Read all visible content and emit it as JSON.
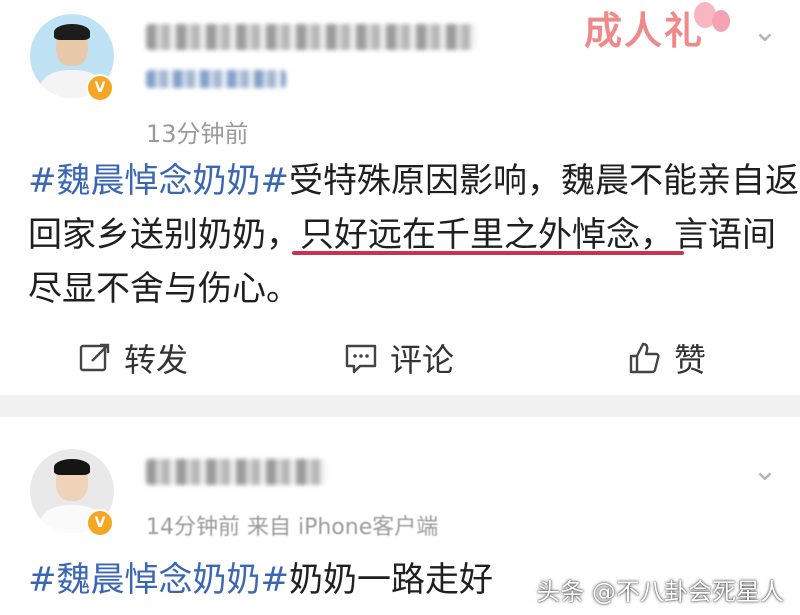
{
  "post1": {
    "time": "13分钟前",
    "sticker_text": "成人礼",
    "hashtag": "#魏晨悼念奶奶#",
    "line1_rest": "受特殊原因影响，魏晨不能亲自返",
    "line2_pre": "回家乡送别奶奶，",
    "line2_underlined": "只好远在千里之外悼念，",
    "line2_post": "言语间",
    "line3": "尽显不舍与伤心。",
    "actions": {
      "repost": "转发",
      "comment": "评论",
      "like": "赞"
    }
  },
  "post2": {
    "time_source": "14分钟前  来自 iPhone客户端",
    "hashtag": "#魏晨悼念奶奶#",
    "text": "奶奶一路走好"
  },
  "watermark": "头条 @不八卦会死星人",
  "colors": {
    "hashtag": "#3b66b4",
    "underline": "#c8324a",
    "verified_badge": "#f5a623"
  }
}
